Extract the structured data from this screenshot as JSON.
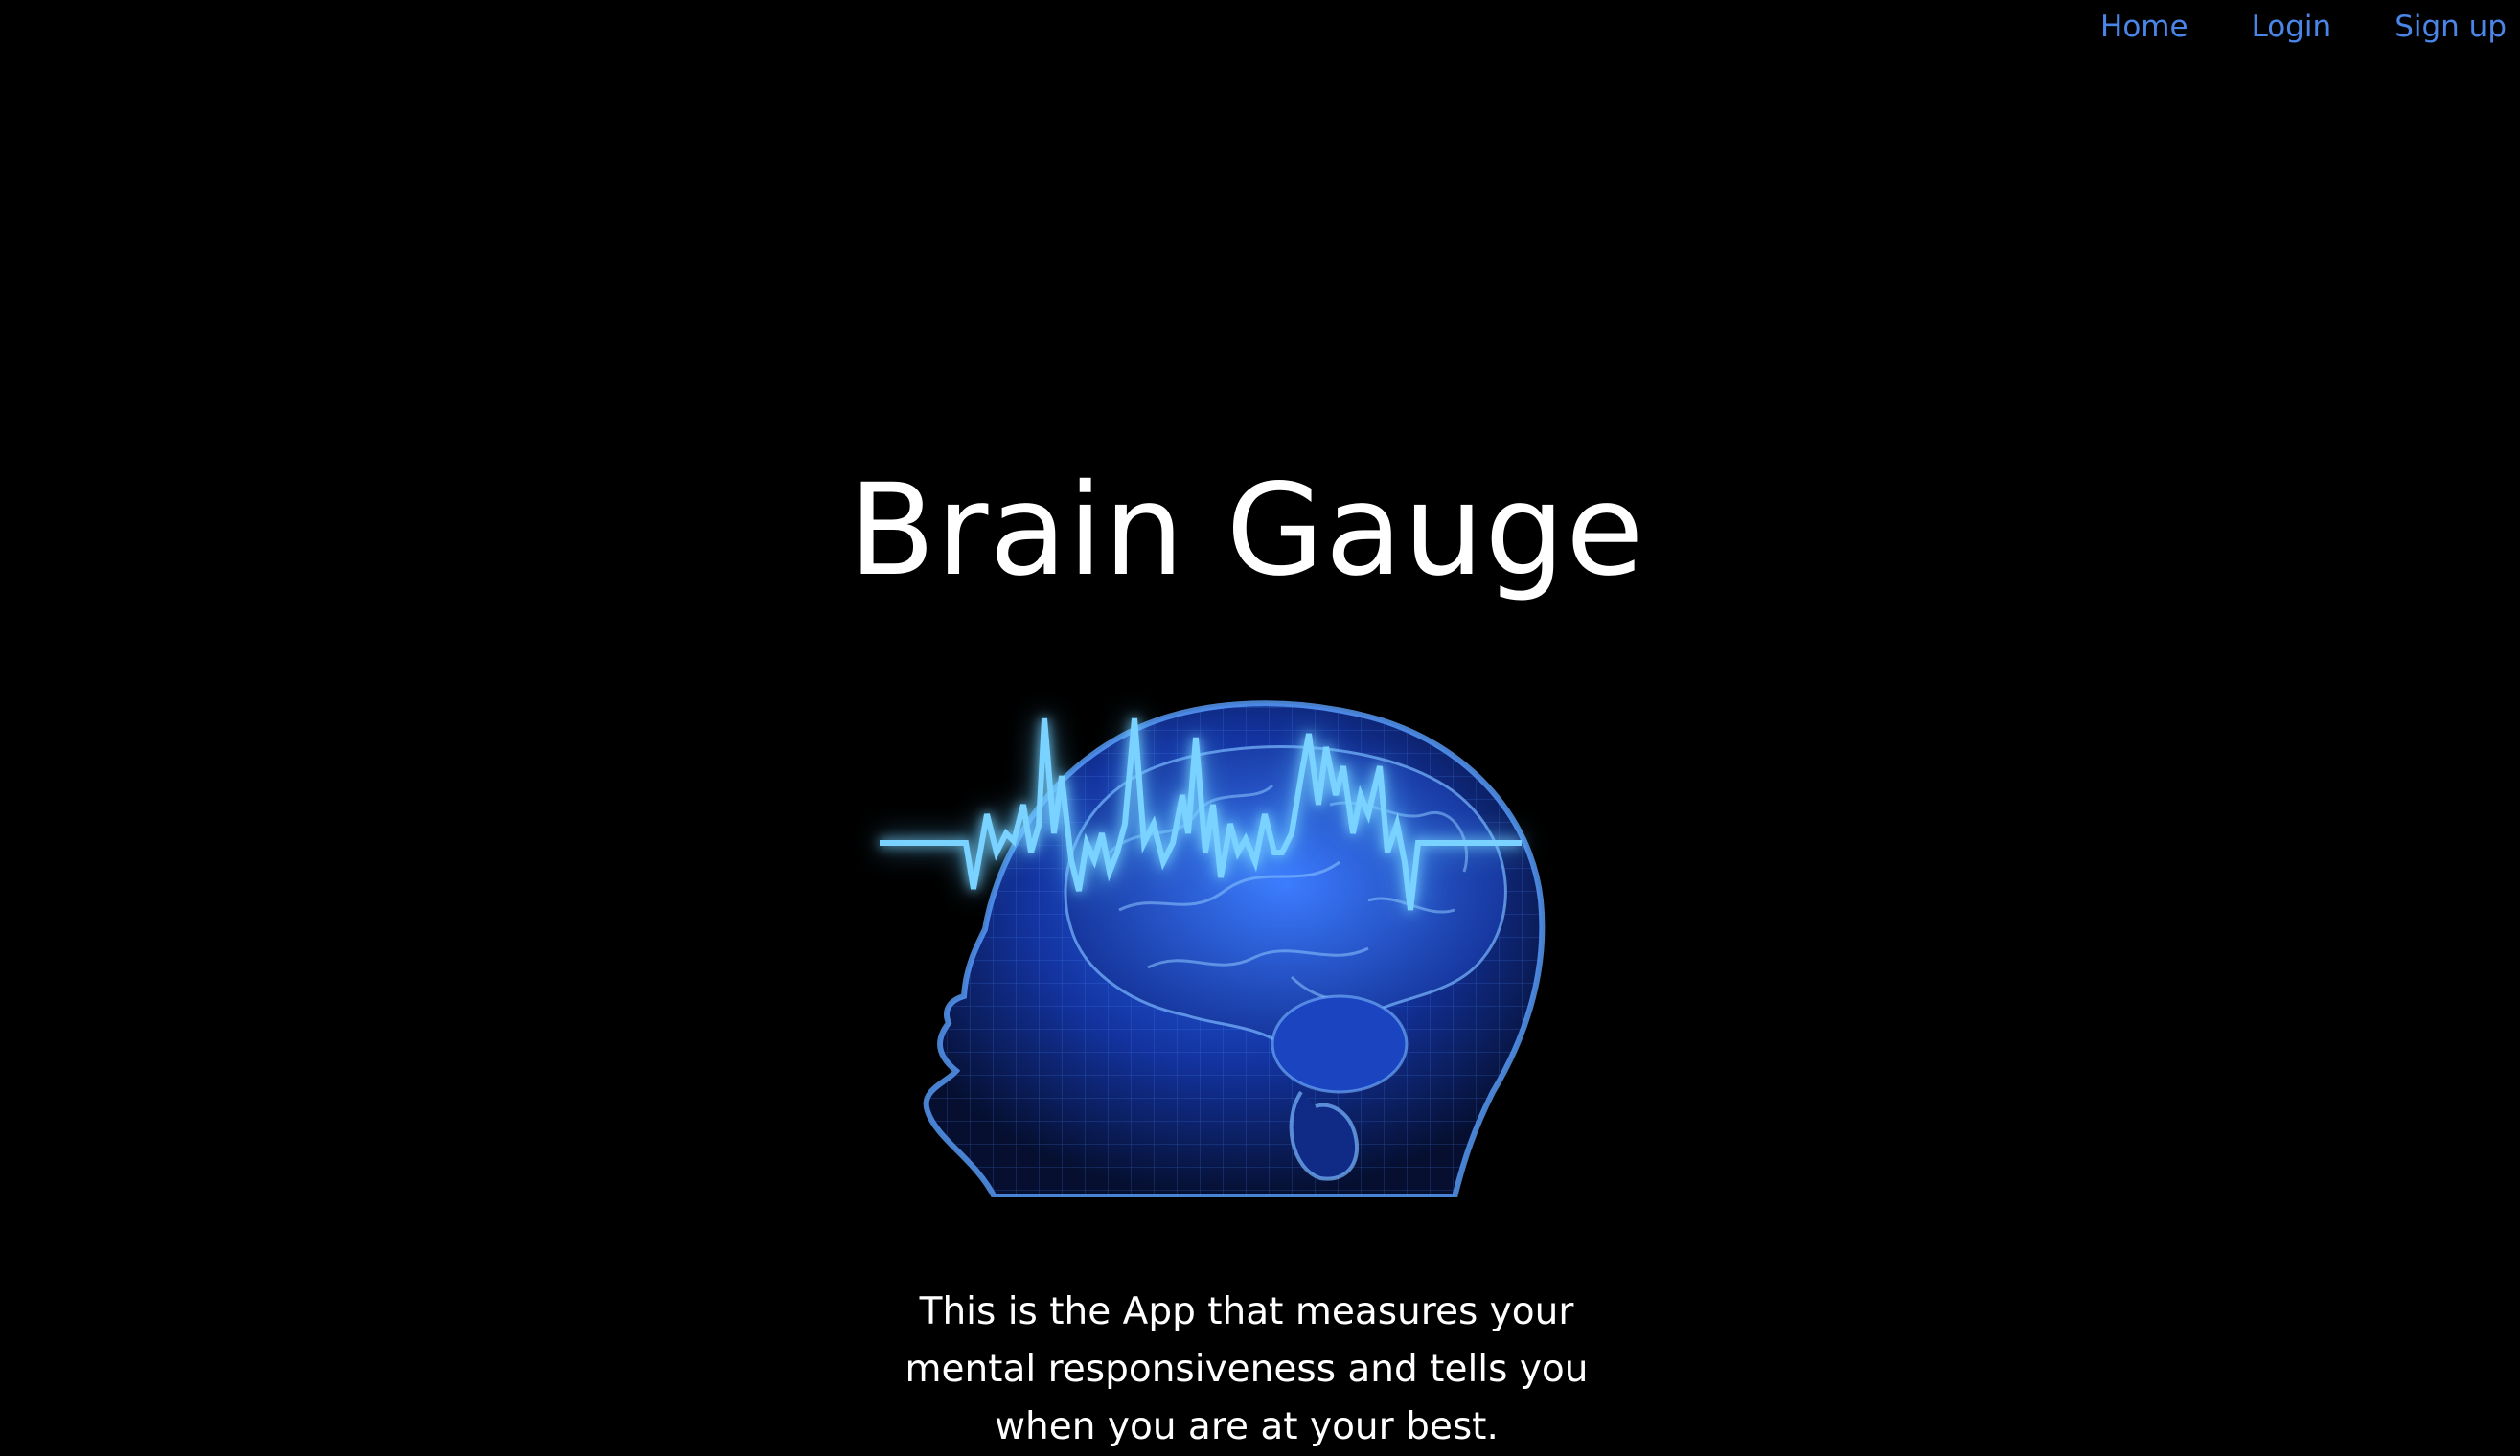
{
  "nav": {
    "items": [
      {
        "label": "Home"
      },
      {
        "label": "Login"
      },
      {
        "label": "Sign up"
      }
    ]
  },
  "hero": {
    "title": "Brain Gauge",
    "image_icon": "brain-wave-head-icon",
    "tagline": [
      "This is the App that measures your",
      "mental responsiveness and tells you",
      "when you are at your best."
    ]
  },
  "colors": {
    "background": "#000000",
    "link": "#4a86e8",
    "text": "#ffffff",
    "glow": "#5bc8ff",
    "head": "#1e4fd6"
  }
}
